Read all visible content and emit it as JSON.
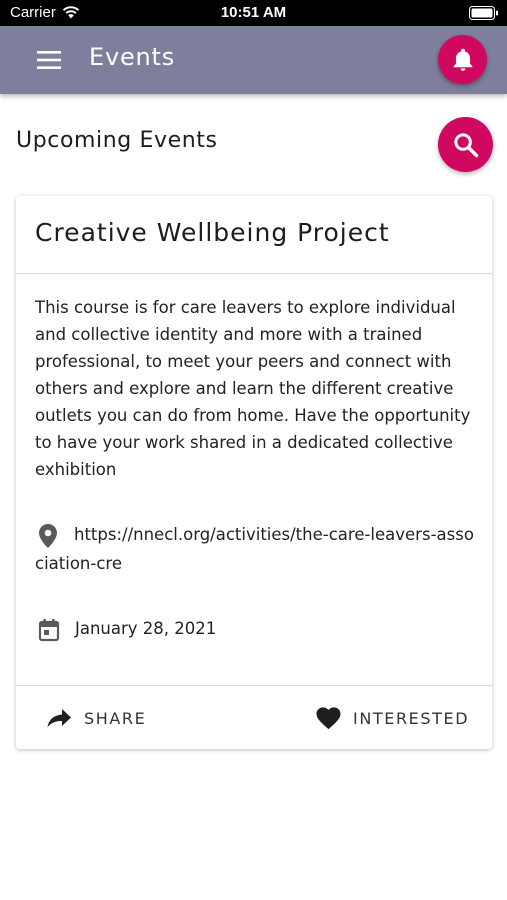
{
  "status_bar": {
    "carrier": "Carrier",
    "time": "10:51 AM"
  },
  "app_bar": {
    "title": "Events",
    "menu_icon": "hamburger-menu-icon",
    "notification_icon": "bell-icon"
  },
  "section": {
    "title": "Upcoming Events",
    "search_icon": "magnify-icon"
  },
  "event": {
    "title": "Creative Wellbeing Project",
    "description": "This course is for care leavers to explore individual and collective identity and more with a trained professional, to meet your peers and connect with others and explore and learn the different creative outlets you can do from home. Have the opportunity to have your work shared in a dedicated collective exhibition",
    "link": "https://nnecl.org/activities/the-care-leavers-association-cre",
    "date": "January 28, 2021",
    "actions": {
      "share_label": "SHARE",
      "interested_label": "INTERESTED"
    }
  },
  "colors": {
    "app_bar": "#7d7f9c",
    "accent": "#d0085f"
  }
}
